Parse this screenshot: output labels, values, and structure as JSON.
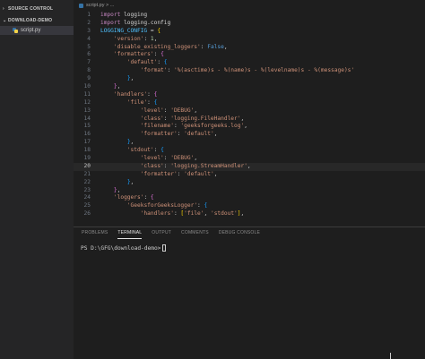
{
  "sidebar": {
    "section1": "SOURCE CONTROL",
    "section2": "DOWNLOAD-DEMO",
    "file": "script.py"
  },
  "editor": {
    "breadcrumb": "script.py > ...",
    "active_line": "20",
    "lines": [
      {
        "n": "1",
        "html": "<span class='kw'>import</span> logging"
      },
      {
        "n": "2",
        "html": "<span class='kw'>import</span> logging.config"
      },
      {
        "n": "3",
        "html": "<span class='var'>LOGGING_CONFIG</span> = <span class='br1'>{</span>"
      },
      {
        "n": "4",
        "html": "    <span class='str'>'version'</span>: <span class='num'>1</span>,"
      },
      {
        "n": "5",
        "html": "    <span class='str'>'disable_existing_loggers'</span>: <span class='bool'>False</span>,"
      },
      {
        "n": "6",
        "html": "    <span class='str'>'formatters'</span>: <span class='br2'>{</span>"
      },
      {
        "n": "7",
        "html": "        <span class='str'>'default'</span>: <span class='br3'>{</span>"
      },
      {
        "n": "8",
        "html": "            <span class='str'>'format'</span>: <span class='str'>'%(asctime)s - %(name)s - %(levelname)s - %(message)s'</span>"
      },
      {
        "n": "9",
        "html": "        <span class='br3'>}</span>,"
      },
      {
        "n": "10",
        "html": "    <span class='br2'>}</span>,"
      },
      {
        "n": "11",
        "html": "    <span class='str'>'handlers'</span>: <span class='br2'>{</span>"
      },
      {
        "n": "12",
        "html": "        <span class='str'>'file'</span>: <span class='br3'>{</span>"
      },
      {
        "n": "13",
        "html": "            <span class='str'>'level'</span>: <span class='str'>'DEBUG'</span>,"
      },
      {
        "n": "14",
        "html": "            <span class='str'>'class'</span>: <span class='str'>'logging.FileHandler'</span>,"
      },
      {
        "n": "15",
        "html": "            <span class='str'>'filename'</span>: <span class='str'>'geeksforgeeks.log'</span>,"
      },
      {
        "n": "16",
        "html": "            <span class='str'>'formatter'</span>: <span class='str'>'default'</span>,"
      },
      {
        "n": "17",
        "html": "        <span class='br3'>}</span>,"
      },
      {
        "n": "18",
        "html": "        <span class='str'>'stdout'</span>: <span class='br3'>{</span>"
      },
      {
        "n": "19",
        "html": "            <span class='str'>'level'</span>: <span class='str'>'DEBUG'</span>,"
      },
      {
        "n": "20",
        "html": "            <span class='str'>'class'</span>: <span class='str'>'logging.StreamHandler'</span>,"
      },
      {
        "n": "21",
        "html": "            <span class='str'>'formatter'</span>: <span class='str'>'default'</span>,"
      },
      {
        "n": "22",
        "html": "        <span class='br3'>}</span>,"
      },
      {
        "n": "23",
        "html": "    <span class='br2'>}</span>,"
      },
      {
        "n": "24",
        "html": "    <span class='str'>'loggers'</span>: <span class='br2'>{</span>"
      },
      {
        "n": "25",
        "html": "        <span class='str'>'GeeksforGeeksLogger'</span>: <span class='br3'>{</span>"
      },
      {
        "n": "26",
        "html": "            <span class='str'>'handlers'</span>: <span class='br1'>[</span><span class='str'>'file'</span>, <span class='str'>'stdout'</span><span class='br1'>]</span>,"
      }
    ]
  },
  "panel": {
    "tabs": [
      {
        "label": "PROBLEMS",
        "active": false
      },
      {
        "label": "TERMINAL",
        "active": true
      },
      {
        "label": "OUTPUT",
        "active": false
      },
      {
        "label": "COMMENTS",
        "active": false
      },
      {
        "label": "DEBUG CONSOLE",
        "active": false
      }
    ],
    "terminal_prompt": "PS D:\\GFG\\download-demo>"
  }
}
